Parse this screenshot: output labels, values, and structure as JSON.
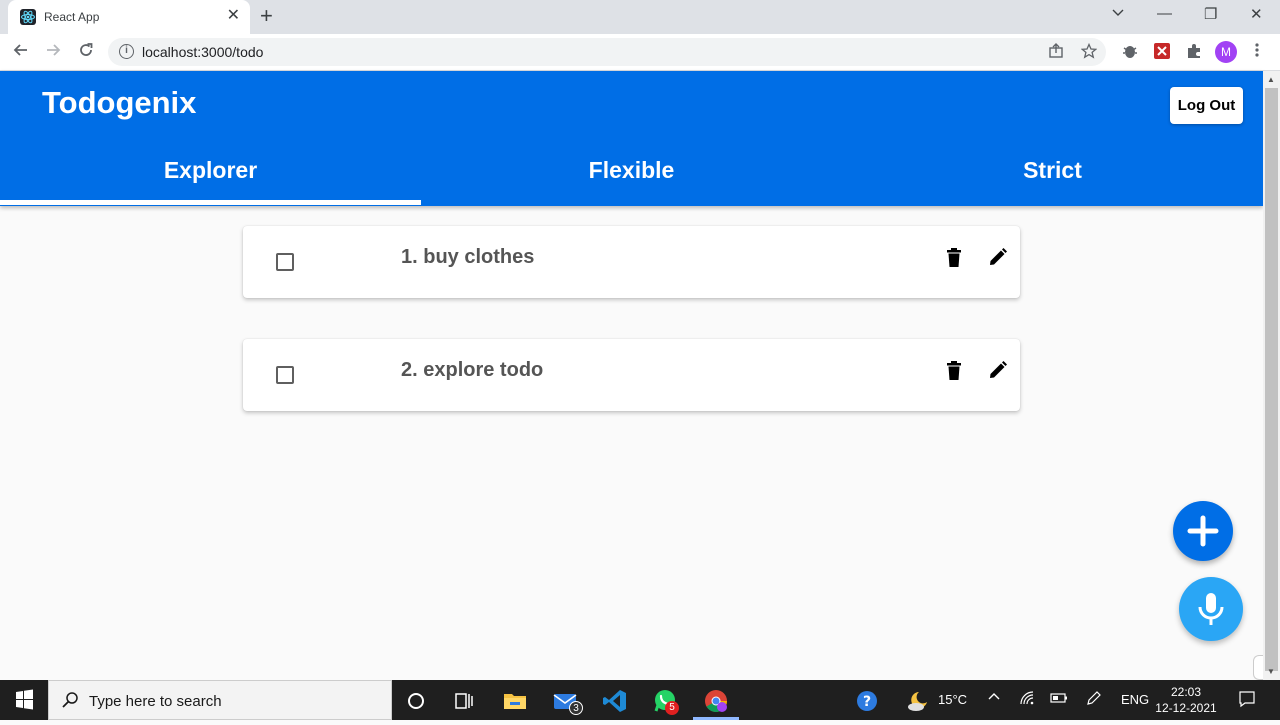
{
  "browser": {
    "tab_title": "React App",
    "tab_close": "✕",
    "new_tab": "+",
    "url": "localhost:3000/todo",
    "profile_initial": "M",
    "window_controls": {
      "minimize": "—",
      "restore": "❐",
      "close": "✕"
    }
  },
  "app": {
    "brand": "Todogenix",
    "logout_label": "Log Out",
    "tabs": [
      {
        "label": "Explorer",
        "active": true
      },
      {
        "label": "Flexible",
        "active": false
      },
      {
        "label": "Strict",
        "active": false
      }
    ],
    "todos": [
      {
        "text": "1. buy clothes",
        "checked": false
      },
      {
        "text": "2. explore todo",
        "checked": false
      }
    ],
    "colors": {
      "primary": "#006ee6",
      "mic": "#2aa6f5"
    }
  },
  "taskbar": {
    "search_placeholder": "Type here to search",
    "mail_badge": "3",
    "whatsapp_badge": "5",
    "temperature": "15°C",
    "language": "ENG",
    "time": "22:03",
    "date": "12-12-2021"
  }
}
